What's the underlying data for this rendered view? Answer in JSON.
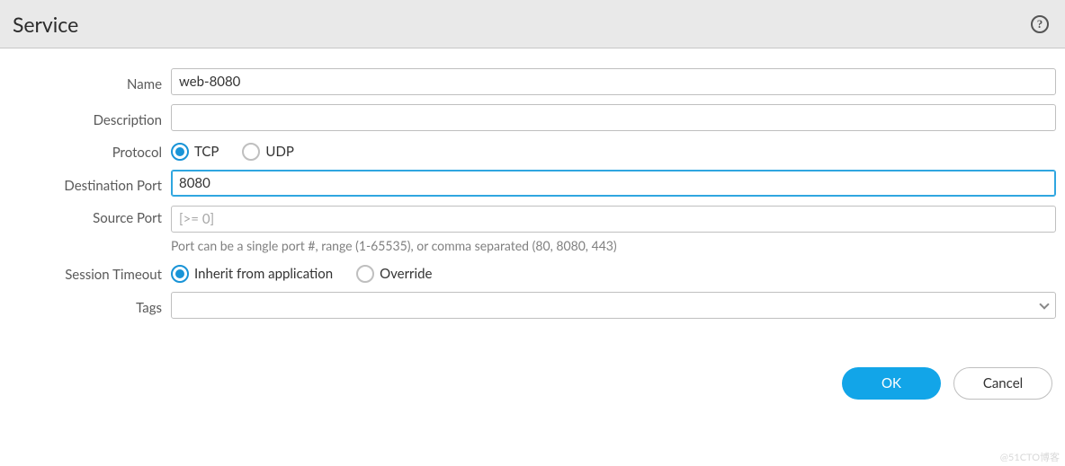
{
  "header": {
    "title": "Service"
  },
  "form": {
    "name": {
      "label": "Name",
      "value": "web-8080"
    },
    "description": {
      "label": "Description",
      "value": ""
    },
    "protocol": {
      "label": "Protocol",
      "options": [
        "TCP",
        "UDP"
      ],
      "selected": "TCP"
    },
    "destination_port": {
      "label": "Destination Port",
      "value": "8080"
    },
    "source_port": {
      "label": "Source Port",
      "value": "",
      "placeholder": "[>= 0]"
    },
    "port_hint": "Port can be a single port #, range (1-65535), or comma separated (80, 8080, 443)",
    "session_timeout": {
      "label": "Session Timeout",
      "options": [
        "Inherit from application",
        "Override"
      ],
      "selected": "Inherit from application"
    },
    "tags": {
      "label": "Tags",
      "value": ""
    }
  },
  "footer": {
    "ok": "OK",
    "cancel": "Cancel"
  },
  "watermark": "@51CTO博客"
}
